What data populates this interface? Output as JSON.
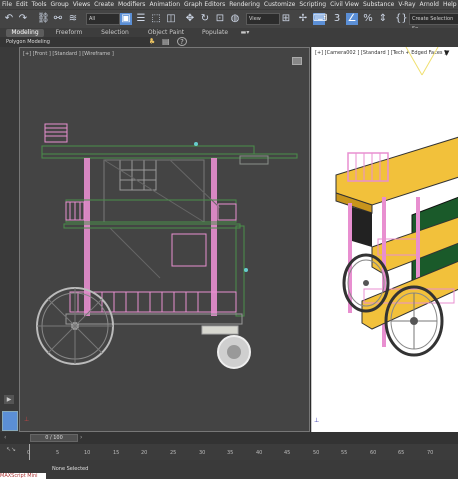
{
  "menu": [
    "File",
    "Edit",
    "Tools",
    "Group",
    "Views",
    "Create",
    "Modifiers",
    "Animation",
    "Graph Editors",
    "Rendering",
    "Customize",
    "Scripting",
    "Civil View",
    "Substance",
    "V-Ray",
    "Arnold",
    "Help"
  ],
  "toolbar": {
    "filter_value": "All",
    "refcoord_value": "View",
    "selection_set_placeholder": "Create Selection Se"
  },
  "ribbon": {
    "tabs": [
      "Modeling",
      "Freeform",
      "Selection",
      "Object Paint",
      "Populate"
    ],
    "active_tab": "Modeling",
    "panel_label": "Polygon Modeling"
  },
  "viewports": {
    "front_label": "[+] [Front ] [Standard ] [Wireframe ]",
    "camera_label": "[+] [Camera002 ] [Standard ] [Tech + Edged Faces ]"
  },
  "timeline": {
    "frame_display": "0 / 100",
    "ticks": [
      "0",
      "5",
      "10",
      "15",
      "20",
      "25",
      "30",
      "35",
      "40",
      "45",
      "50",
      "55",
      "60",
      "65",
      "70"
    ]
  },
  "status": {
    "selection_text": "None Selected",
    "maxscript_label": "MAXScript Mini"
  },
  "colors": {
    "wire_pink": "#e88fd0",
    "wire_green": "#4a8f4a",
    "wood": "#f2c13b",
    "panel_dark": "#1a5a2a"
  }
}
